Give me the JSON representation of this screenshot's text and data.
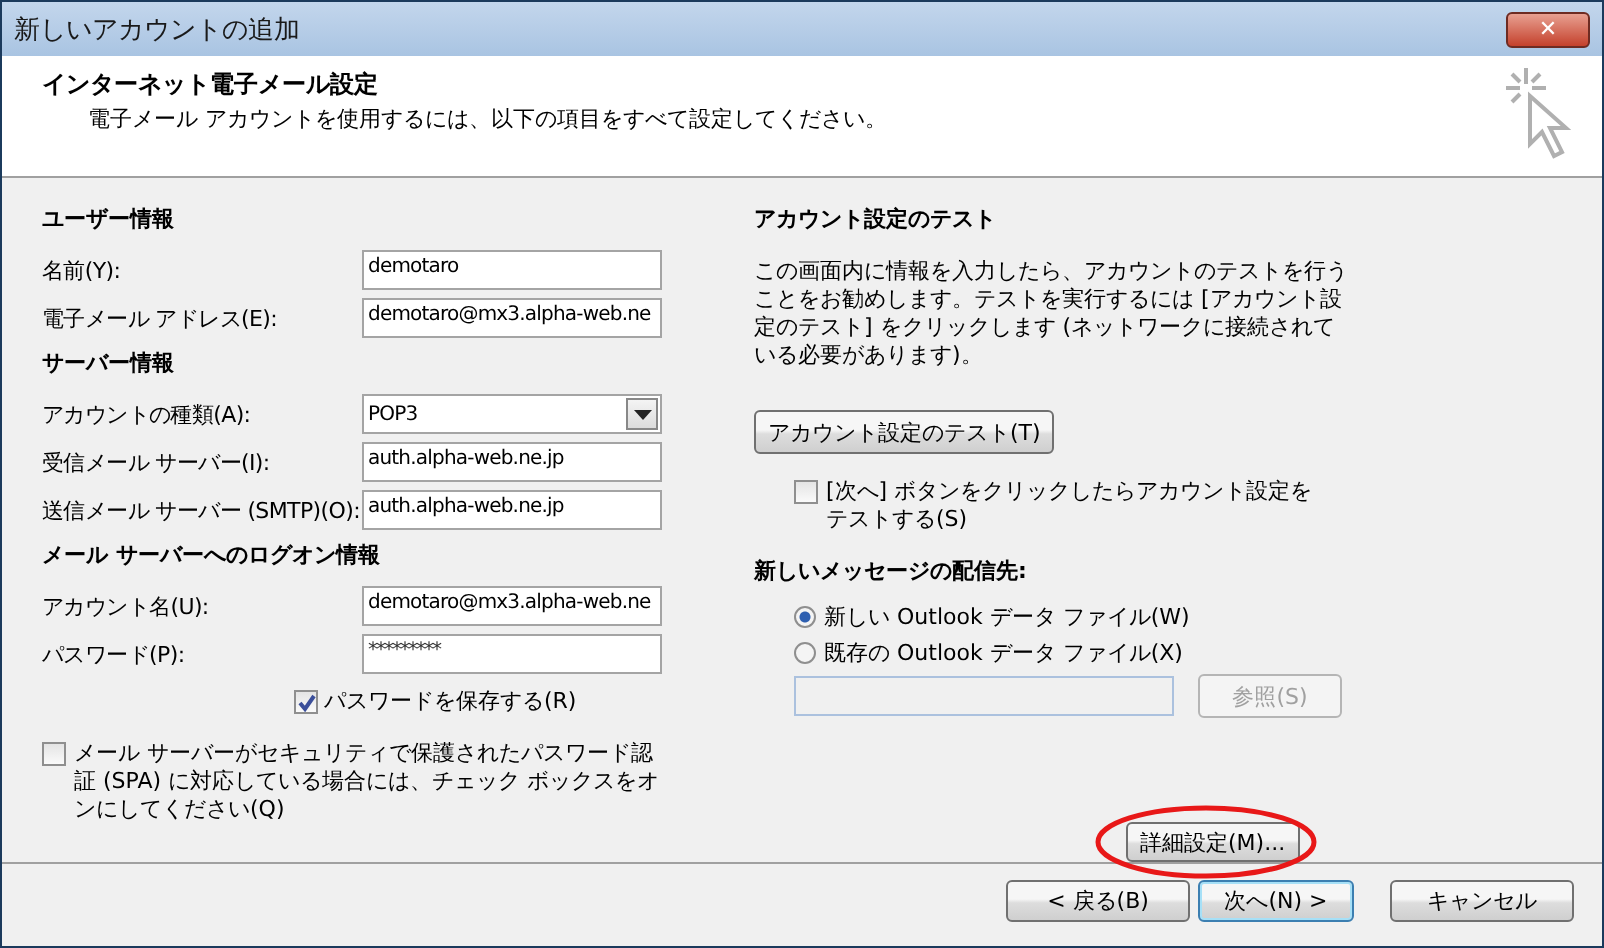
{
  "window": {
    "title": "新しいアカウントの追加",
    "close": "✕"
  },
  "header": {
    "title": "インターネット電子メール設定",
    "subtitle": "電子メール アカウントを使用するには、以下の項目をすべて設定してください。"
  },
  "sections": [
    {
      "heading": "ユーザー情報",
      "fields": [
        {
          "label": "名前(Y):",
          "value": "demotaro",
          "kind": "text"
        },
        {
          "label": "電子メール アドレス(E):",
          "value": "demotaro@mx3.alpha-web.ne",
          "kind": "text"
        }
      ]
    },
    {
      "heading": "サーバー情報",
      "fields": [
        {
          "label": "アカウントの種類(A):",
          "value": "POP3",
          "kind": "dropdown"
        },
        {
          "label": "受信メール サーバー(I):",
          "value": "auth.alpha-web.ne.jp",
          "kind": "text"
        },
        {
          "label": "送信メール サーバー (SMTP)(O):",
          "value": "auth.alpha-web.ne.jp",
          "kind": "text"
        }
      ]
    },
    {
      "heading": "メール サーバーへのログオン情報",
      "fields": [
        {
          "label": "アカウント名(U):",
          "value": "demotaro@mx3.alpha-web.ne",
          "kind": "text"
        },
        {
          "label": "パスワード(P):",
          "value": "*********",
          "kind": "password"
        }
      ]
    }
  ],
  "remember_password": {
    "label": "パスワードを保存する(R)",
    "checked": true
  },
  "spa": {
    "label": "メール サーバーがセキュリティで保護されたパスワード認証 (SPA) に対応している場合には、チェック ボックスをオンにしてください(Q)",
    "checked": false
  },
  "test": {
    "heading": "アカウント設定のテスト",
    "description": "この画面内に情報を入力したら、アカウントのテストを行うことをお勧めします。テストを実行するには [アカウント設定のテスト] をクリックします (ネットワークに接続されている必要があります)。",
    "button": "アカウント設定のテスト(T)",
    "auto_test": {
      "label": "[次へ] ボタンをクリックしたらアカウント設定をテストする(S)",
      "checked": false
    }
  },
  "delivery": {
    "heading": "新しいメッセージの配信先:",
    "options": [
      {
        "label": "新しい Outlook データ ファイル(W)",
        "selected": true
      },
      {
        "label": "既存の Outlook データ ファイル(X)",
        "selected": false
      }
    ],
    "browse": {
      "label": "参照(S)",
      "disabled": true
    }
  },
  "more_settings": {
    "label": "詳細設定(M)...",
    "highlighted": true
  },
  "buttons": [
    {
      "label": "< 戻る(B)",
      "kind": "normal"
    },
    {
      "label": "次へ(N) >",
      "kind": "default"
    },
    {
      "label": "キャンセル",
      "kind": "normal"
    }
  ]
}
